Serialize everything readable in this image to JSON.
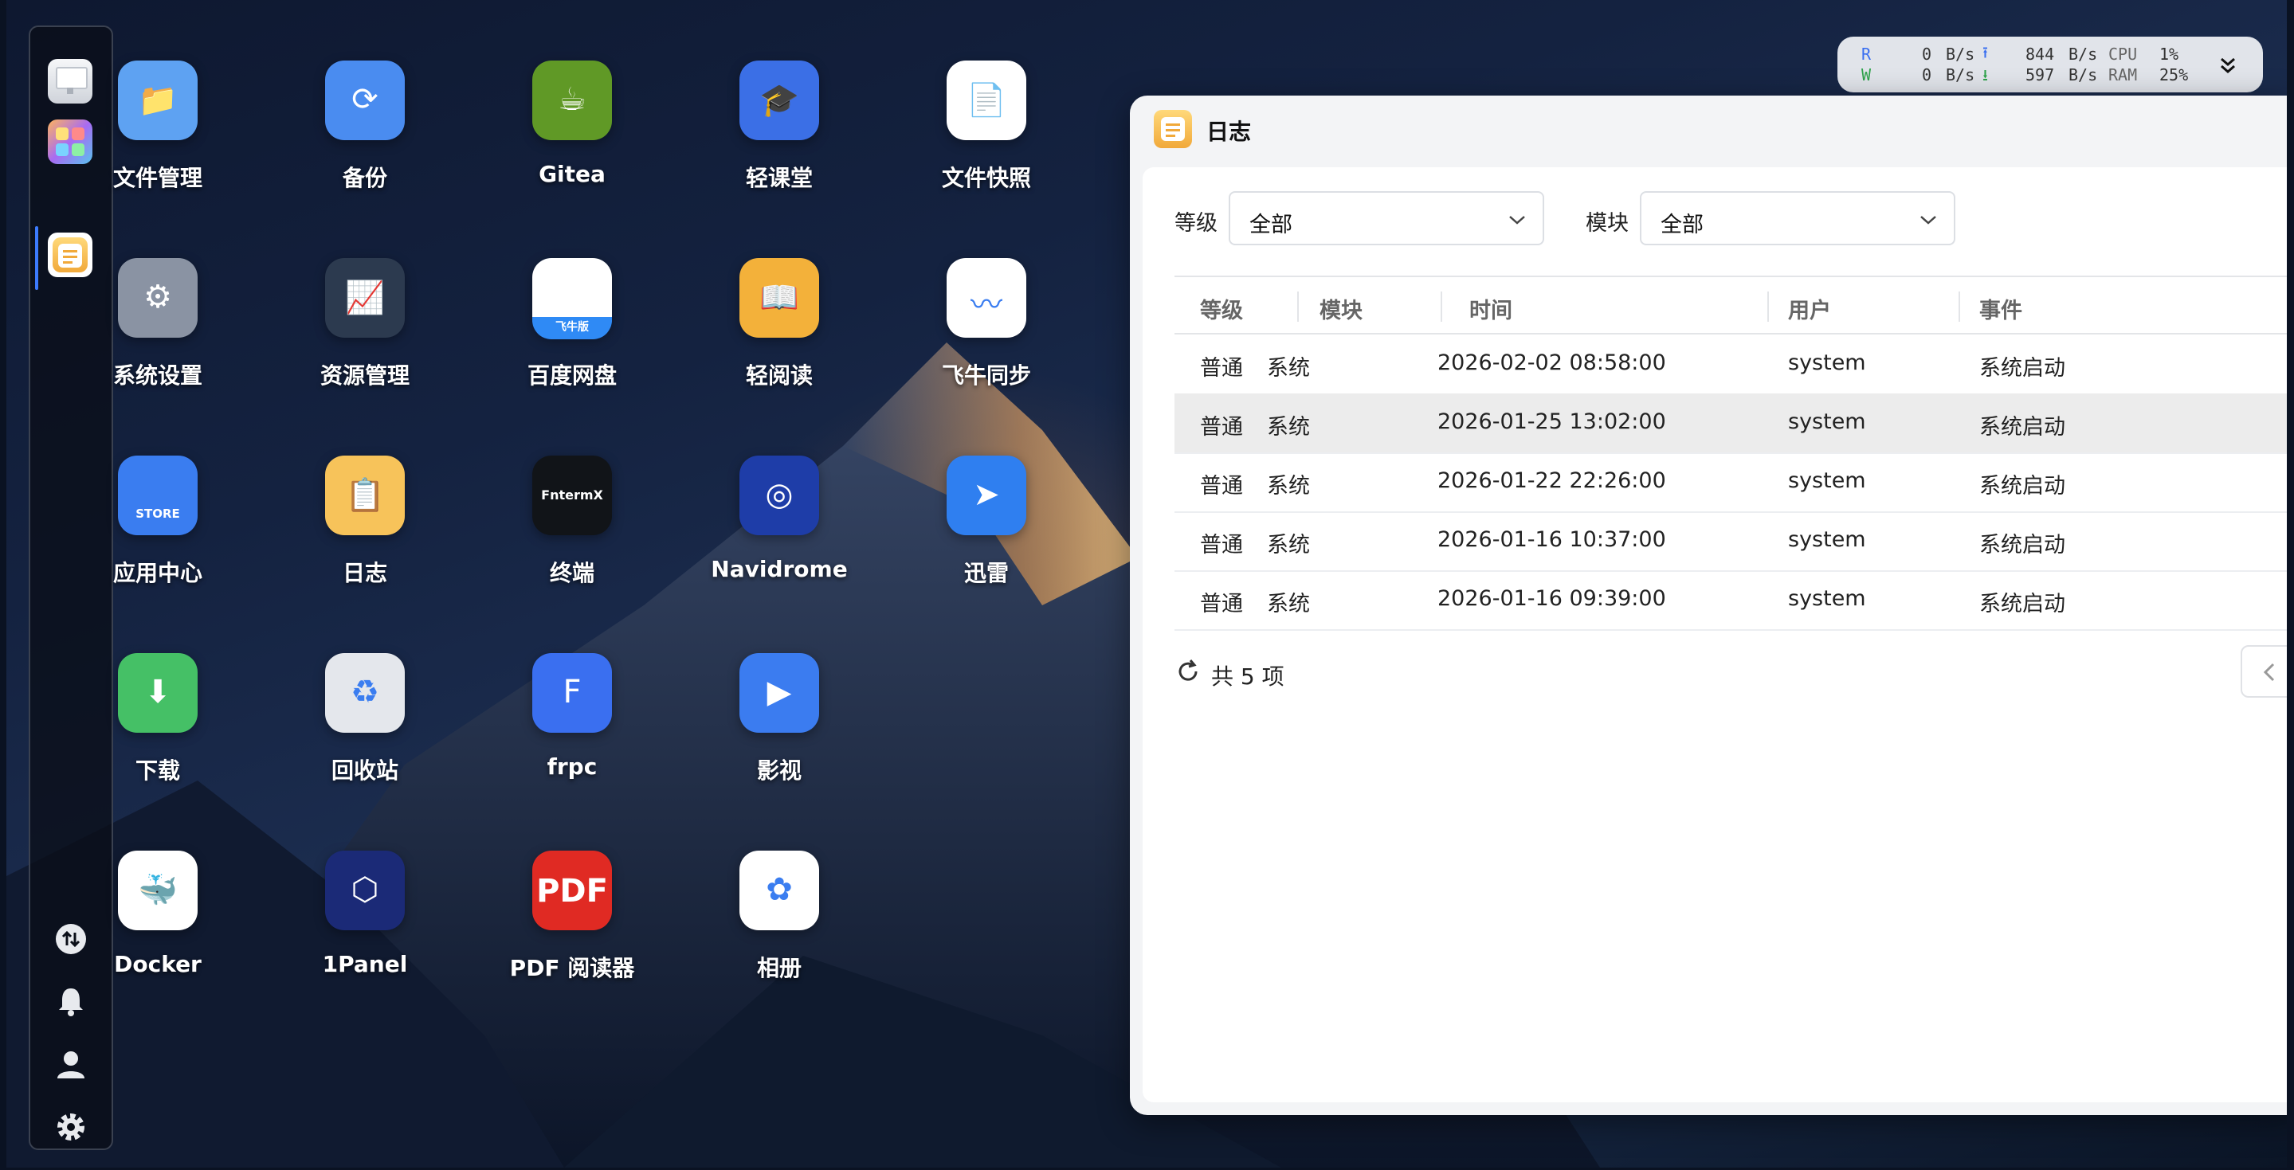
{
  "dock": {
    "items": [
      {
        "name": "desktop-icon"
      },
      {
        "name": "app-grid-icon"
      },
      {
        "name": "log-app-icon",
        "active": true
      }
    ],
    "bottom_icons": [
      "transfer-icon",
      "bell-icon",
      "user-icon",
      "gear-icon"
    ]
  },
  "desktop_apps": [
    {
      "label": "文件管理",
      "icon": "folder-icon",
      "color": "#5ea2f2"
    },
    {
      "label": "备份",
      "icon": "backup-sync-icon",
      "color": "#4a8cf0"
    },
    {
      "label": "Gitea",
      "icon": "gitea-teacup-icon",
      "color": "#609926"
    },
    {
      "label": "轻课堂",
      "icon": "graduation-cap-icon",
      "color": "#3b6fe6"
    },
    {
      "label": "文件快照",
      "icon": "file-snapshot-icon",
      "color": "#ffffff"
    },
    {
      "label": "系统设置",
      "icon": "settings-gear-icon",
      "color": "#8a93a3"
    },
    {
      "label": "资源管理",
      "icon": "resource-monitor-icon",
      "color": "#2c3a4f"
    },
    {
      "label": "百度网盘",
      "icon": "baidu-netdisk-icon",
      "color": "#ffffff",
      "badge": "飞牛版"
    },
    {
      "label": "轻阅读",
      "icon": "book-icon",
      "color": "#f3b13a"
    },
    {
      "label": "飞牛同步",
      "icon": "sync-wave-icon",
      "color": "#ffffff"
    },
    {
      "label": "应用中心",
      "icon": "store-bag-icon",
      "color": "#3a7df0",
      "badge": "STORE"
    },
    {
      "label": "日志",
      "icon": "clipboard-log-icon",
      "color": "#f7c35a"
    },
    {
      "label": "终端",
      "icon": "terminal-icon",
      "color": "#111418",
      "badge": "FntermX"
    },
    {
      "label": "Navidrome",
      "icon": "vinyl-record-icon",
      "color": "#1e3da8"
    },
    {
      "label": "迅雷",
      "icon": "thunder-bird-icon",
      "color": "#2f7ff0"
    },
    {
      "label": "下载",
      "icon": "download-arrow-icon",
      "color": "#45c066"
    },
    {
      "label": "回收站",
      "icon": "recycle-bin-icon",
      "color": "#e4e7ec"
    },
    {
      "label": "frpc",
      "icon": "frpc-logo-icon",
      "color": "#3a6ff0"
    },
    {
      "label": "影视",
      "icon": "video-play-icon",
      "color": "#3b7cf0"
    },
    {
      "label": "Docker",
      "icon": "docker-whale-icon",
      "color": "#ffffff"
    },
    {
      "label": "1Panel",
      "icon": "1panel-hexagon-icon",
      "color": "#1b2a77"
    },
    {
      "label": "PDF 阅读器",
      "icon": "pdf-file-icon",
      "color": "#e02a23",
      "badge": "PDF"
    },
    {
      "label": "相册",
      "icon": "photos-flower-icon",
      "color": "#ffffff"
    }
  ],
  "system_monitor": {
    "read_label": "R",
    "write_label": "W",
    "read_value": "0",
    "write_value": "0",
    "unit": "B/s",
    "upload_value": "844",
    "download_value": "597",
    "cpu_label": "CPU",
    "cpu_value": "1%",
    "ram_label": "RAM",
    "ram_value": "25%"
  },
  "log_window": {
    "title": "日志",
    "filters": {
      "level_label": "等级",
      "level_value": "全部",
      "module_label": "模块",
      "module_value": "全部"
    },
    "columns": [
      "等级",
      "模块",
      "时间",
      "用户",
      "事件"
    ],
    "rows": [
      [
        "普通",
        "系统",
        "2026-02-02 08:58:00",
        "system",
        "系统启动"
      ],
      [
        "普通",
        "系统",
        "2026-01-25 13:02:00",
        "system",
        "系统启动"
      ],
      [
        "普通",
        "系统",
        "2026-01-22 22:26:00",
        "system",
        "系统启动"
      ],
      [
        "普通",
        "系统",
        "2026-01-16 10:37:00",
        "system",
        "系统启动"
      ],
      [
        "普通",
        "系统",
        "2026-01-16 09:39:00",
        "system",
        "系统启动"
      ]
    ],
    "highlighted_row": 1,
    "footer": {
      "total_text": "共 5 项"
    }
  }
}
